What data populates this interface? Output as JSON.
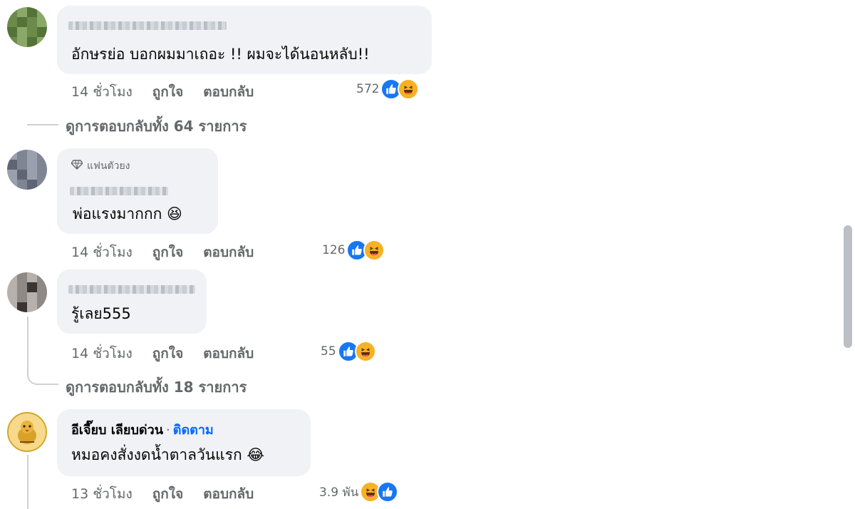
{
  "comments": [
    {
      "text": "อักษรย่อ บอกผมมาเถอะ !! ผมจะได้นอนหลับ!!",
      "time": "14 ชั่วโมง",
      "like_action": "ถูกใจ",
      "reply_action": "ตอบกลับ",
      "reaction_count": "572",
      "reactions": [
        "like-icon",
        "haha-icon"
      ]
    },
    {
      "badge": "แฟนตัวยง",
      "text": "พ่อแรงมากกก 😆",
      "time": "14 ชั่วโมง",
      "like_action": "ถูกใจ",
      "reply_action": "ตอบกลับ",
      "reaction_count": "126",
      "reactions": [
        "like-icon",
        "haha-icon"
      ]
    },
    {
      "text": "รู้เลย555",
      "time": "14 ชั่วโมง",
      "like_action": "ถูกใจ",
      "reply_action": "ตอบกลับ",
      "reaction_count": "55",
      "reactions": [
        "like-icon",
        "haha-icon"
      ]
    },
    {
      "author": "อีเจี๊ยบ เลียบด่วน",
      "separator": "·",
      "follow": "ติดตาม",
      "text": "หมอคงสั่งงดน้ำตาลวันแรก 😂",
      "time": "13 ชั่วโมง",
      "like_action": "ถูกใจ",
      "reply_action": "ตอบกลับ",
      "reaction_count": "3.9 พัน",
      "reactions": [
        "haha-icon",
        "like-icon"
      ]
    }
  ],
  "view_replies": [
    "ดูการตอบกลับทั้ง 64 รายการ",
    "ดูการตอบกลับทั้ง 18 รายการ"
  ],
  "colors": {
    "bubble": "#f0f2f5",
    "meta_text": "#65676b",
    "like_blue": "#1877f2",
    "haha_yellow": "#f7b125",
    "follow_blue": "#0866ff"
  }
}
